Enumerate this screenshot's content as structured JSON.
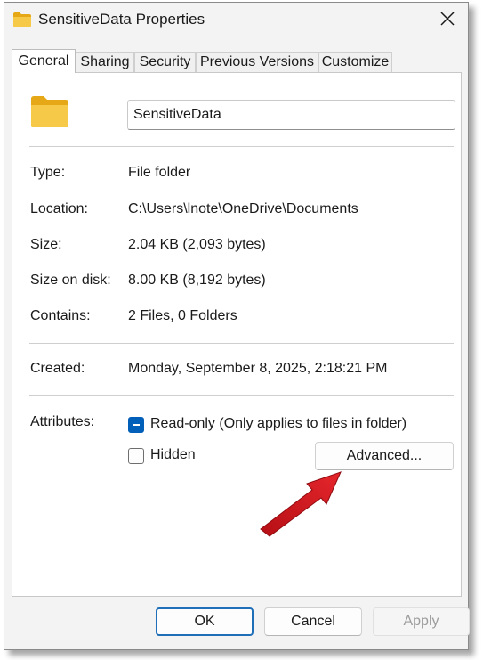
{
  "window": {
    "title": "SensitiveData Properties"
  },
  "tabs": [
    {
      "label": "General",
      "active": true
    },
    {
      "label": "Sharing"
    },
    {
      "label": "Security"
    },
    {
      "label": "Previous Versions"
    },
    {
      "label": "Customize"
    }
  ],
  "general": {
    "name_value": "SensitiveData",
    "rows": [
      {
        "label": "Type:",
        "value": "File folder"
      },
      {
        "label": "Location:",
        "value": "C:\\Users\\lnote\\OneDrive\\Documents"
      },
      {
        "label": "Size:",
        "value": "2.04 KB (2,093 bytes)"
      },
      {
        "label": "Size on disk:",
        "value": "8.00 KB (8,192 bytes)"
      },
      {
        "label": "Contains:",
        "value": "2 Files, 0 Folders"
      }
    ],
    "created": {
      "label": "Created:",
      "value": "Monday, September 8, 2025, 2:18:21 PM"
    },
    "attributes": {
      "label": "Attributes:",
      "readonly_label": "Read-only (Only applies to files in folder)",
      "readonly_state": "indeterminate",
      "hidden_label": "Hidden",
      "hidden_state": "unchecked",
      "advanced_label": "Advanced..."
    }
  },
  "footer": {
    "ok_label": "OK",
    "cancel_label": "Cancel",
    "apply_label": "Apply"
  },
  "colors": {
    "accent": "#005fb8",
    "folder": "#f7c948",
    "annotation_arrow": "#d6191f"
  },
  "icons": {
    "title": "folder-icon",
    "close": "close-icon",
    "large": "folder-icon",
    "annotation": "red-arrow-icon"
  }
}
